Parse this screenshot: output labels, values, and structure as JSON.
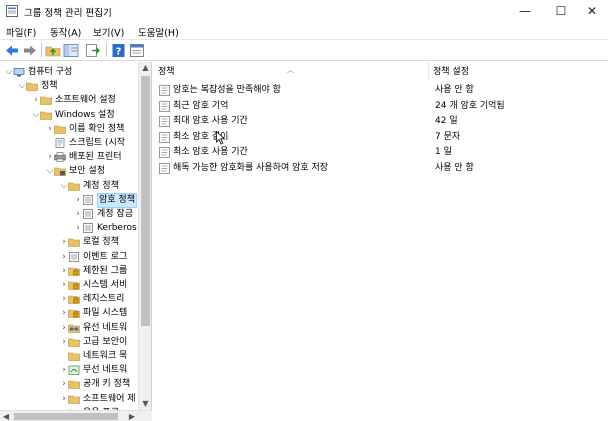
{
  "window": {
    "title": "그룹 정책 관리 편집기",
    "minimize": "—",
    "maximize": "☐",
    "close": "✕"
  },
  "menu": [
    "파일(F)",
    "동작(A)",
    "보기(V)",
    "도움말(H)"
  ],
  "toolbar_icons": [
    "back-arrow-icon",
    "forward-arrow-icon",
    "up-folder-icon",
    "show-tree-icon",
    "export-list-icon",
    "help-icon",
    "properties-icon"
  ],
  "tree": [
    {
      "label": "컴퓨터 구성",
      "chev": "⌵",
      "icon": "computer"
    },
    {
      "label": "정책",
      "chev": "⌵",
      "icon": "folder"
    },
    {
      "label": "소프트웨어 설정",
      "chev": "›",
      "icon": "folder"
    },
    {
      "label": "Windows 설정",
      "chev": "⌵",
      "icon": "folder"
    },
    {
      "label": "이름 확인 정책",
      "chev": "›",
      "icon": "folder"
    },
    {
      "label": "스크립트 (시작",
      "chev": "",
      "icon": "script"
    },
    {
      "label": "배포된 프린터",
      "chev": "›",
      "icon": "printer"
    },
    {
      "label": "보안 설정",
      "chev": "⌵",
      "icon": "security"
    },
    {
      "label": "계정 정책",
      "chev": "⌵",
      "icon": "folder"
    },
    {
      "label": "암호 정책",
      "chev": "›",
      "icon": "policy"
    },
    {
      "label": "계정 잠금",
      "chev": "›",
      "icon": "policy"
    },
    {
      "label": "Kerberos",
      "chev": "›",
      "icon": "policy"
    },
    {
      "label": "로컬 정책",
      "chev": "›",
      "icon": "folder"
    },
    {
      "label": "이벤트 로그",
      "chev": "›",
      "icon": "policy"
    },
    {
      "label": "제한된 그룹",
      "chev": "›",
      "icon": "lockfolder"
    },
    {
      "label": "시스템 서비",
      "chev": "›",
      "icon": "lockfolder"
    },
    {
      "label": "레지스트리",
      "chev": "›",
      "icon": "lockfolder"
    },
    {
      "label": "파일 시스템",
      "chev": "›",
      "icon": "lockfolder"
    },
    {
      "label": "유선 네트워",
      "chev": "›",
      "icon": "wired"
    },
    {
      "label": "고급 보안이",
      "chev": "›",
      "icon": "folder"
    },
    {
      "label": "네트워크 목",
      "chev": "",
      "icon": "folder"
    },
    {
      "label": "무선 네트워",
      "chev": "›",
      "icon": "wireless"
    },
    {
      "label": "공개 키 정책",
      "chev": "›",
      "icon": "folder"
    },
    {
      "label": "소프트웨어 제",
      "chev": "›",
      "icon": "folder"
    },
    {
      "label": "응용 프로",
      "chev": "›",
      "icon": "folder"
    }
  ],
  "columns": {
    "policy": "정책",
    "setting": "정책 설정"
  },
  "policies": [
    {
      "name": "암호는 복잡성을 만족해야 함",
      "value": "사용 안 함"
    },
    {
      "name": "최근 암호 기억",
      "value": "24 개 암호 기억됨"
    },
    {
      "name": "최대 암호 사용 기간",
      "value": "42 일"
    },
    {
      "name": "최소 암호 길이",
      "value": "7 문자"
    },
    {
      "name": "최소 암호 사용 기간",
      "value": "1 일"
    },
    {
      "name": "해독 가능한 암호화를 사용하여 암호 저장",
      "value": "사용 안 함"
    }
  ],
  "colors": {
    "selection": "#cce8ff",
    "folder": "#e8c16a",
    "accent": "#1e78d2"
  }
}
